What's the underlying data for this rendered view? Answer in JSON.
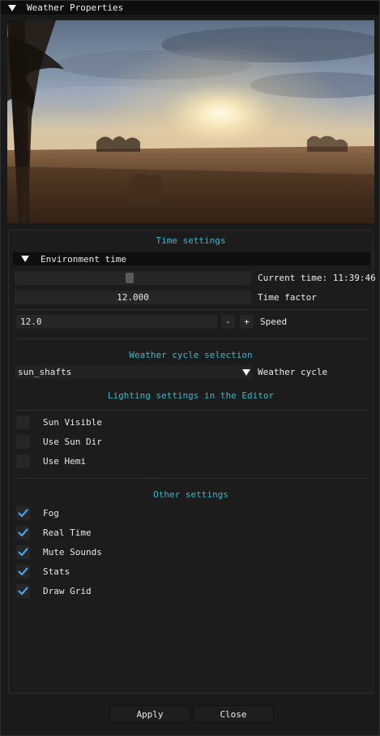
{
  "window": {
    "title": "Weather Properties"
  },
  "time_settings": {
    "section_title": "Time settings",
    "env_header": "Environment time",
    "current_time_label": "Current time: 11:39:46",
    "current_time_fraction": 0.486,
    "time_factor_value": "12.000",
    "time_factor_label": "Time factor",
    "speed_value": "12.0",
    "minus": "-",
    "plus": "+",
    "speed_label": "Speed"
  },
  "weather_cycle": {
    "section_title": "Weather cycle selection",
    "selected": "sun_shafts",
    "label": "Weather cycle"
  },
  "lighting": {
    "section_title": "Lighting settings in the Editor",
    "items": [
      {
        "label": "Sun Visible",
        "checked": false
      },
      {
        "label": "Use Sun Dir",
        "checked": false
      },
      {
        "label": "Use Hemi",
        "checked": false
      }
    ]
  },
  "other": {
    "section_title": "Other settings",
    "items": [
      {
        "label": "Fog",
        "checked": true
      },
      {
        "label": "Real Time",
        "checked": true
      },
      {
        "label": "Mute Sounds",
        "checked": true
      },
      {
        "label": "Stats",
        "checked": true
      },
      {
        "label": "Draw Grid",
        "checked": true
      }
    ]
  },
  "footer": {
    "apply": "Apply",
    "close": "Close"
  },
  "colors": {
    "accent": "#3fb6c6",
    "check": "#4aa3e8",
    "frame": "#262626"
  }
}
